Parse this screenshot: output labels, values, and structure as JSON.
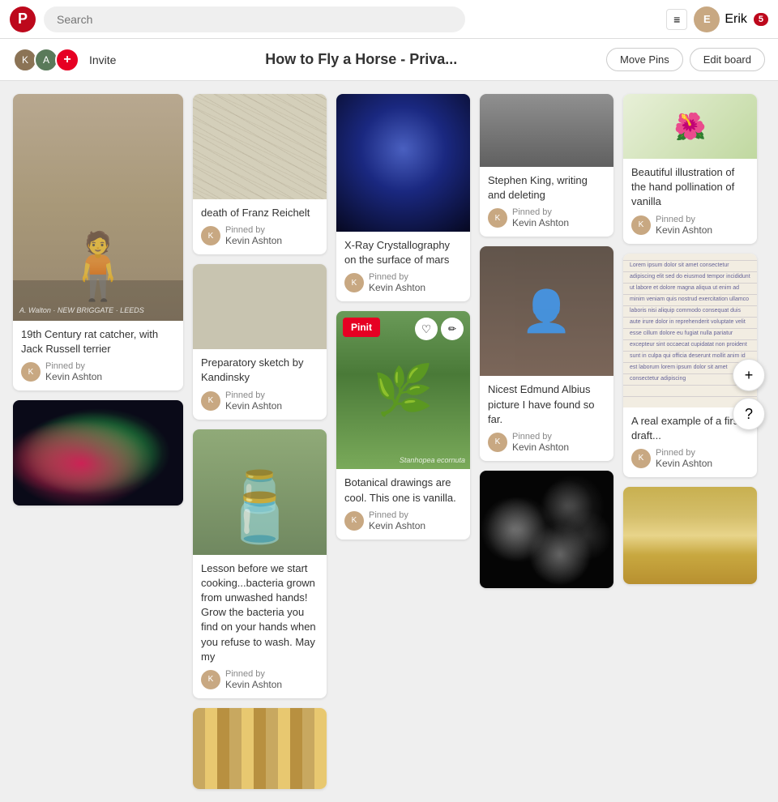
{
  "header": {
    "search_placeholder": "Search",
    "user_name": "Erik",
    "notification_count": "5",
    "hamburger_icon": "≡"
  },
  "sub_header": {
    "board_title": "How to Fly a Horse - Priva...",
    "invite_label": "Invite",
    "move_pins_label": "Move Pins",
    "edit_board_label": "Edit board"
  },
  "pins": [
    {
      "id": "old-photo",
      "desc": "19th Century rat catcher, with Jack Russell terrier",
      "pinned_by_label": "Pinned by",
      "pinner": "Kevin Ashton",
      "image_type": "old-photo"
    },
    {
      "id": "flea",
      "desc": "",
      "pinned_by_label": "",
      "pinner": "",
      "image_type": "flea"
    },
    {
      "id": "sketch",
      "desc": "death of Franz Reichelt",
      "pinned_by_label": "Pinned by",
      "pinner": "Kevin Ashton",
      "image_type": "sketch"
    },
    {
      "id": "sketch2",
      "desc": "Preparatory sketch by Kandinsky",
      "pinned_by_label": "Pinned by",
      "pinner": "Kevin Ashton",
      "image_type": "sketch2"
    },
    {
      "id": "bacteria",
      "desc": "Lesson before we start cooking...bacteria grown from unwashed hands! Grow the bacteria you find on your hands when you refuse to wash. May my",
      "pinned_by_label": "Pinned by",
      "pinner": "Kevin Ashton",
      "image_type": "bacteria"
    },
    {
      "id": "pattern",
      "desc": "",
      "image_type": "pattern"
    },
    {
      "id": "crystallography",
      "desc": "X-Ray Crystallography on the surface of mars",
      "pinned_by_label": "Pinned by",
      "pinner": "Kevin Ashton",
      "image_type": "crystallography"
    },
    {
      "id": "botanical",
      "desc": "Botanical drawings are cool. This one is vanilla.",
      "pinned_by_label": "Pinned by",
      "pinner": "Kevin Ashton",
      "image_type": "botanical",
      "has_overlay": true
    },
    {
      "id": "illustration",
      "desc": "Beautiful illustration of the hand pollination of vanilla",
      "pinned_by_label": "Pinned by",
      "pinner": "Kevin Ashton",
      "image_type": "illustration"
    },
    {
      "id": "stephen",
      "desc": "Stephen King, writing and deleting",
      "pinned_by_label": "Pinned by",
      "pinner": "Kevin Ashton",
      "image_type": "stephen"
    },
    {
      "id": "portrait",
      "desc": "Nicest Edmund Albius picture I have found so far.",
      "pinned_by_label": "Pinned by",
      "pinner": "Kevin Ashton",
      "image_type": "portrait"
    },
    {
      "id": "diatoms",
      "desc": "",
      "image_type": "diatoms"
    },
    {
      "id": "draft",
      "desc": "A real example of a first draft...",
      "pinned_by_label": "Pinned by",
      "pinner": "Kevin Ashton",
      "image_type": "draft"
    },
    {
      "id": "textile",
      "desc": "",
      "image_type": "textile"
    },
    {
      "id": "text-doc",
      "desc": "",
      "image_type": "text-doc"
    }
  ],
  "float_buttons": {
    "plus_label": "+",
    "question_label": "?"
  }
}
